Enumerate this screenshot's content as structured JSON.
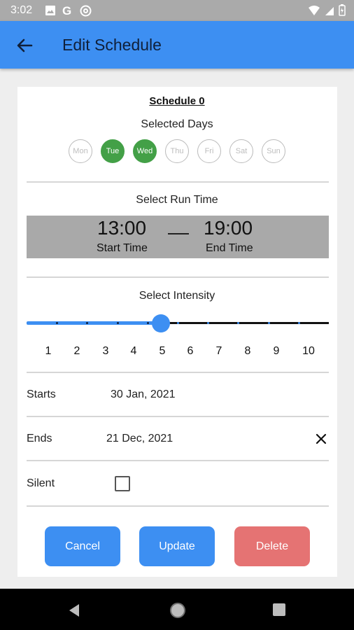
{
  "status_bar": {
    "time": "3:02"
  },
  "appbar": {
    "title": "Edit Schedule"
  },
  "schedule": {
    "title": "Schedule 0",
    "days_label": "Selected Days",
    "days": [
      {
        "label": "Mon",
        "selected": false
      },
      {
        "label": "Tue",
        "selected": true
      },
      {
        "label": "Wed",
        "selected": true
      },
      {
        "label": "Thu",
        "selected": false
      },
      {
        "label": "Fri",
        "selected": false
      },
      {
        "label": "Sat",
        "selected": false
      },
      {
        "label": "Sun",
        "selected": false
      }
    ]
  },
  "run_time": {
    "label": "Select Run Time",
    "start_time": "13:00",
    "start_caption": "Start Time",
    "end_time": "19:00",
    "end_caption": "End Time"
  },
  "intensity": {
    "label": "Select Intensity",
    "value": 5,
    "scale": [
      "1",
      "2",
      "3",
      "4",
      "5",
      "6",
      "7",
      "8",
      "9",
      "10"
    ]
  },
  "fields": {
    "starts_label": "Starts",
    "starts_value": "30 Jan, 2021",
    "ends_label": "Ends",
    "ends_value": "21 Dec, 2021",
    "silent_label": "Silent",
    "silent_checked": false
  },
  "buttons": {
    "cancel": "Cancel",
    "update": "Update",
    "delete": "Delete"
  },
  "colors": {
    "primary": "#3d8ff2",
    "selected_day": "#43a047",
    "delete": "#e57373",
    "time_box": "#a9a9a9"
  }
}
